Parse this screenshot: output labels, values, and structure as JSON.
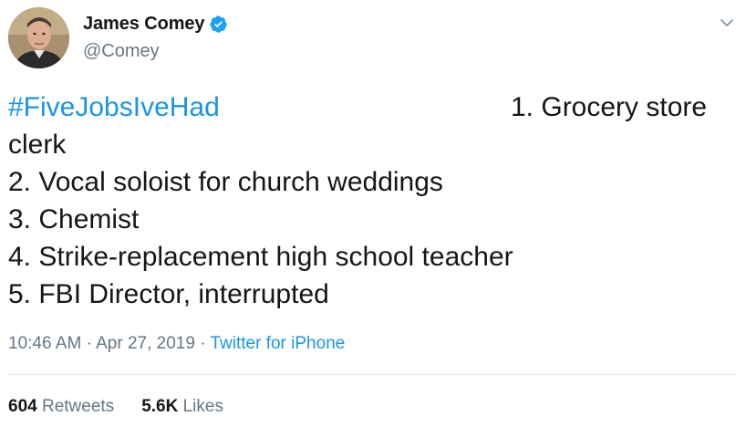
{
  "author": {
    "display_name": "James Comey",
    "handle": "@Comey",
    "verified": true
  },
  "tweet": {
    "hashtag": "#FiveJobsIveHad",
    "lines": [
      "1.  Grocery store",
      "clerk",
      "2.  Vocal soloist for church weddings",
      "3.  Chemist",
      "4.  Strike-replacement high school teacher",
      "5.  FBI Director, interrupted"
    ]
  },
  "meta": {
    "time": "10:46 AM",
    "separator": "·",
    "date": "Apr 27, 2019",
    "source": "Twitter for iPhone"
  },
  "stats": {
    "retweets_count": "604",
    "retweets_label": "Retweets",
    "likes_count": "5.6K",
    "likes_label": "Likes"
  },
  "icons": {
    "verified": "verified-badge-icon",
    "caret": "chevron-down-icon"
  },
  "colors": {
    "link": "#1b95e0",
    "secondary_text": "#657786",
    "primary_text": "#14171a",
    "verified_badge": "#1da1f2"
  }
}
